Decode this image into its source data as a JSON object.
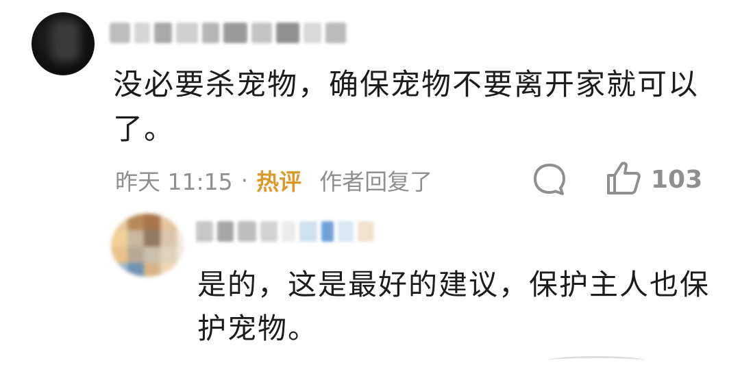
{
  "comment": {
    "author_avatar": "blurred-user-avatar",
    "author_name": "",
    "text": "没必要杀宠物，确保宠物不要离开家就可以了。",
    "time": "昨天 11:15",
    "separator": "·",
    "hot_label": "热评",
    "author_replied_label": "作者回复了",
    "comment_icon": "speech-bubble-icon",
    "like_icon": "thumbs-up-icon",
    "like_count": "103",
    "colors": {
      "hot": "#d99a2b",
      "meta": "#8f8f8f",
      "text": "#1c1c1c"
    }
  },
  "reply": {
    "author_avatar": "blurred-user-avatar",
    "author_name": "",
    "text": "是的，这是最好的建议，保护主人也保护宠物。"
  }
}
